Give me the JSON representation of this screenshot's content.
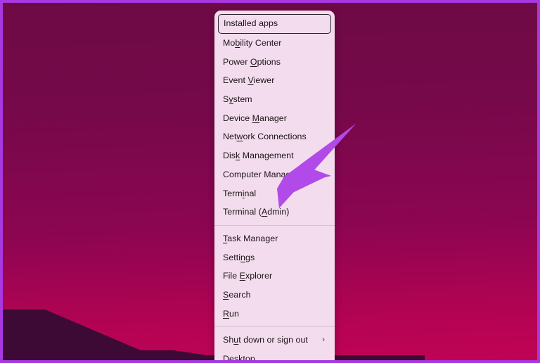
{
  "desktop": {
    "wallpaper_description": "magenta-purple gradient desktop",
    "colors": {
      "background_top": "#6d0a45",
      "background_bottom": "#c00355",
      "screen_border": "#a838e0",
      "wallpaper_shape": "#3c0a35"
    }
  },
  "context_menu": {
    "name": "Win+X power user menu",
    "background": "#f3dced",
    "text_color": "#1c1418",
    "groups": [
      {
        "items": [
          {
            "label": "Installed apps",
            "accel": "",
            "selected": true,
            "submenu": false
          },
          {
            "label": "Mobility Center",
            "accel": "b",
            "selected": false,
            "submenu": false
          },
          {
            "label": "Power Options",
            "accel": "O",
            "selected": false,
            "submenu": false
          },
          {
            "label": "Event Viewer",
            "accel": "V",
            "selected": false,
            "submenu": false
          },
          {
            "label": "System",
            "accel": "y",
            "selected": false,
            "submenu": false
          },
          {
            "label": "Device Manager",
            "accel": "M",
            "selected": false,
            "submenu": false
          },
          {
            "label": "Network Connections",
            "accel": "w",
            "selected": false,
            "submenu": false
          },
          {
            "label": "Disk Management",
            "accel": "k",
            "selected": false,
            "submenu": false
          },
          {
            "label": "Computer Management",
            "accel": "g",
            "selected": false,
            "submenu": false
          },
          {
            "label": "Terminal",
            "accel": "i",
            "selected": false,
            "submenu": false
          },
          {
            "label": "Terminal (Admin)",
            "accel": "A",
            "selected": false,
            "submenu": false
          }
        ]
      },
      {
        "items": [
          {
            "label": "Task Manager",
            "accel": "T",
            "selected": false,
            "submenu": false
          },
          {
            "label": "Settings",
            "accel": "n",
            "selected": false,
            "submenu": false
          },
          {
            "label": "File Explorer",
            "accel": "E",
            "selected": false,
            "submenu": false
          },
          {
            "label": "Search",
            "accel": "S",
            "selected": false,
            "submenu": false
          },
          {
            "label": "Run",
            "accel": "R",
            "selected": false,
            "submenu": false
          }
        ]
      },
      {
        "items": [
          {
            "label": "Shut down or sign out",
            "accel": "u",
            "selected": false,
            "submenu": true
          },
          {
            "label": "Desktop",
            "accel": "D",
            "selected": false,
            "submenu": false
          }
        ]
      }
    ],
    "submenu_chevron_glyph": "›"
  },
  "annotation": {
    "type": "arrow",
    "color": "#b14ae8",
    "points_to": "Terminal (Admin)"
  }
}
